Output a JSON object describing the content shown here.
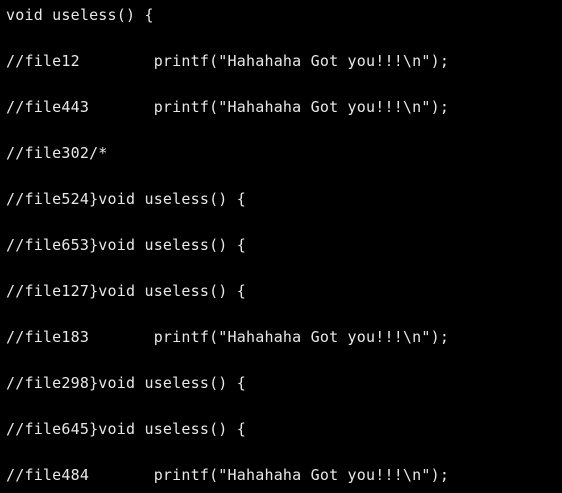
{
  "terminal": {
    "background": "#000000",
    "text_color": "#e8e8e8",
    "lines": [
      "void useless() {",
      "//file12        printf(\"Hahahaha Got you!!!\\n\");",
      "//file443       printf(\"Hahahaha Got you!!!\\n\");",
      "//file302/*",
      "//file524}void useless() {",
      "//file653}void useless() {",
      "//file127}void useless() {",
      "//file183       printf(\"Hahahaha Got you!!!\\n\");",
      "//file298}void useless() {",
      "//file645}void useless() {",
      "//file484       printf(\"Hahahaha Got you!!!\\n\");"
    ]
  }
}
